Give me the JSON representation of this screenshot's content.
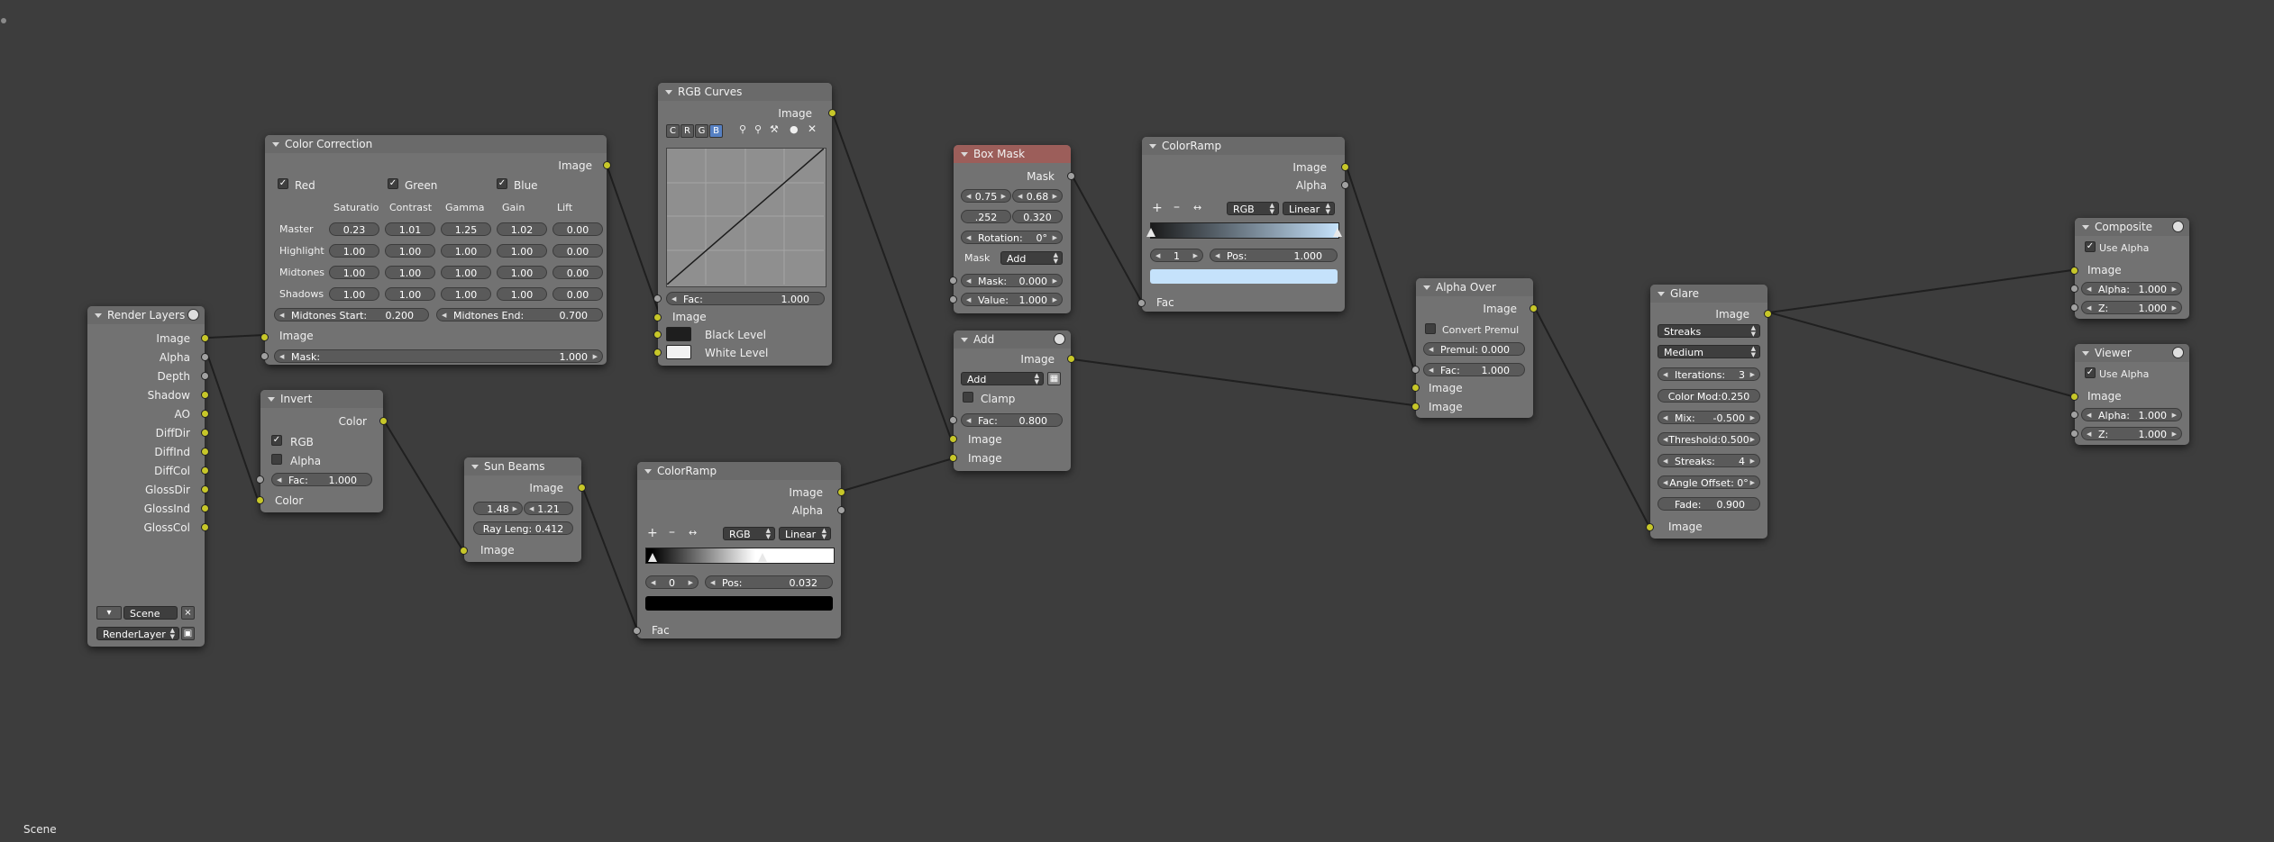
{
  "footer": {
    "scene_label": "Scene"
  },
  "colors": {
    "socket_color": "#c7c729",
    "socket_value": "#a1a1a1",
    "link": "#202020",
    "background": "#3d3d3d",
    "node_body": "#727272",
    "mask_header": "#9c5e5a"
  },
  "render_layers": {
    "title": "Render Layers",
    "outputs": [
      "Image",
      "Alpha",
      "Depth",
      "Shadow",
      "AO",
      "DiffDir",
      "DiffInd",
      "DiffCol",
      "GlossDir",
      "GlossInd",
      "GlossCol"
    ],
    "scene": "Scene",
    "layer": "RenderLayer"
  },
  "color_correction": {
    "title": "Color Correction",
    "output": "Image",
    "channels": [
      "Red",
      "Green",
      "Blue"
    ],
    "columns": [
      "Saturatio",
      "Contrast",
      "Gamma",
      "Gain",
      "Lift"
    ],
    "rows": [
      {
        "label": "Master",
        "values": [
          "0.23",
          "1.01",
          "1.25",
          "1.02",
          "0.00"
        ]
      },
      {
        "label": "Highlight",
        "values": [
          "1.00",
          "1.00",
          "1.00",
          "1.00",
          "0.00"
        ]
      },
      {
        "label": "Midtones",
        "values": [
          "1.00",
          "1.00",
          "1.00",
          "1.00",
          "0.00"
        ]
      },
      {
        "label": "Shadows",
        "values": [
          "1.00",
          "1.00",
          "1.00",
          "1.00",
          "0.00"
        ]
      }
    ],
    "midtones_start_label": "Midtones Start:",
    "midtones_start": "0.200",
    "midtones_end_label": "Midtones End:",
    "midtones_end": "0.700",
    "input_image": "Image",
    "mask_label": "Mask:",
    "mask": "1.000"
  },
  "rgb_curves": {
    "title": "RGB Curves",
    "output": "Image",
    "channel_buttons": [
      "C",
      "R",
      "G",
      "B"
    ],
    "active_channel": "B",
    "fac_label": "Fac:",
    "fac": "1.000",
    "input_image": "Image",
    "black_level": "Black Level",
    "white_level": "White Level"
  },
  "invert": {
    "title": "Invert",
    "output": "Color",
    "rgb_label": "RGB",
    "alpha_label": "Alpha",
    "fac_label": "Fac:",
    "fac": "1.000",
    "input": "Color"
  },
  "sun_beams": {
    "title": "Sun Beams",
    "output": "Image",
    "x": "1.48",
    "y": "1.21",
    "ray_label": "Ray Leng:",
    "ray": "0.412",
    "input": "Image"
  },
  "colorramp_bottom": {
    "title": "ColorRamp",
    "outputs": [
      "Image",
      "Alpha"
    ],
    "color_mode": "RGB",
    "interp": "Linear",
    "stop_index": "0",
    "pos_label": "Pos:",
    "pos": "0.032",
    "input": "Fac",
    "stop_color": "#000000"
  },
  "box_mask": {
    "title": "Box Mask",
    "output": "Mask",
    "x": "0.75",
    "y": "0.68",
    "width": ".252",
    "height": "0.320",
    "rotation_label": "Rotation:",
    "rotation": "0°",
    "mask_type_label": "Mask",
    "mask_type": "Add",
    "mask_label": "Mask:",
    "mask_value": "0.000",
    "value_label": "Value:",
    "value": "1.000"
  },
  "add": {
    "title": "Add",
    "output": "Image",
    "blend": "Add",
    "clamp_label": "Clamp",
    "fac_label": "Fac:",
    "fac": "0.800",
    "inputs": [
      "Image",
      "Image"
    ]
  },
  "colorramp_top": {
    "title": "ColorRamp",
    "outputs": [
      "Image",
      "Alpha"
    ],
    "color_mode": "RGB",
    "interp": "Linear",
    "stop_index": "1",
    "pos_label": "Pos:",
    "pos": "1.000",
    "input": "Fac",
    "stop_color": "#c5e2fb"
  },
  "alpha_over": {
    "title": "Alpha Over",
    "output": "Image",
    "convert_label": "Convert Premul",
    "premul_label": "Premul:",
    "premul": "0.000",
    "fac_label": "Fac:",
    "fac": "1.000",
    "inputs": [
      "Image",
      "Image"
    ]
  },
  "glare": {
    "title": "Glare",
    "output": "Image",
    "type": "Streaks",
    "quality": "Medium",
    "iterations_label": "Iterations:",
    "iterations": "3",
    "color_mod_label": "Color Mod:",
    "color_mod": "0.250",
    "mix_label": "Mix:",
    "mix": "-0.500",
    "threshold_label": "Threshold:",
    "threshold": "0.500",
    "streaks_label": "Streaks:",
    "streaks": "4",
    "angle_label": "Angle Offset:",
    "angle": "0°",
    "fade_label": "Fade:",
    "fade": "0.900",
    "input": "Image"
  },
  "composite": {
    "title": "Composite",
    "use_alpha": "Use Alpha",
    "image": "Image",
    "alpha_label": "Alpha:",
    "alpha": "1.000",
    "z_label": "Z:",
    "z": "1.000"
  },
  "viewer": {
    "title": "Viewer",
    "use_alpha": "Use Alpha",
    "image": "Image",
    "alpha_label": "Alpha:",
    "alpha": "1.000",
    "z_label": "Z:",
    "z": "1.000"
  }
}
